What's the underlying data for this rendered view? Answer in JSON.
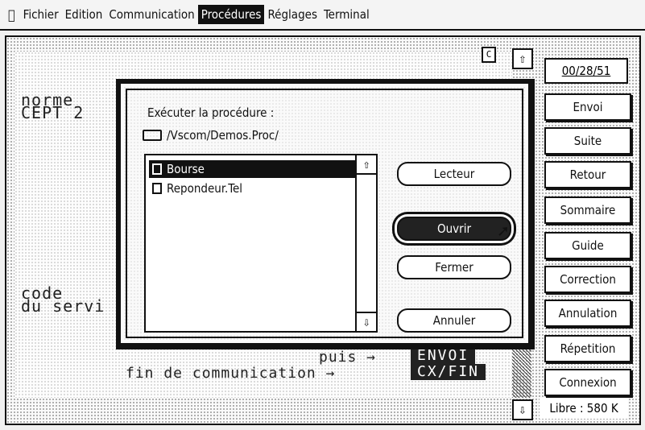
{
  "menubar": {
    "apple_icon": "apple-icon",
    "items": [
      "Fichier",
      "Edition",
      "Communication",
      "Procédures",
      "Réglages",
      "Terminal"
    ],
    "active_index": 3
  },
  "terminal": {
    "left_label_1": "norme",
    "left_label_2": "CEPT 2",
    "left_label_3": "code",
    "left_label_4": "du servi",
    "line_puis": "puis →",
    "line_fin": "fin de communication →",
    "key_envoi": "ENVOI",
    "key_cxfin": "CX/FIN",
    "indicator": "C"
  },
  "sidebar": {
    "date": "00/28/51",
    "buttons": [
      "Envoi",
      "Suite",
      "Retour",
      "Sommaire",
      "Guide",
      "Correction",
      "Annulation",
      "Répetition",
      "Connexion"
    ],
    "free": "Libre : 580 K"
  },
  "dialog": {
    "title": "Exécuter la procédure :",
    "path": "/Vscom/Demos.Proc/",
    "files": [
      "Bourse",
      "Repondeur.Tel"
    ],
    "selected_index": 0,
    "buttons": {
      "lecteur": "Lecteur",
      "ouvrir": "Ouvrir",
      "fermer": "Fermer",
      "annuler": "Annuler"
    }
  }
}
